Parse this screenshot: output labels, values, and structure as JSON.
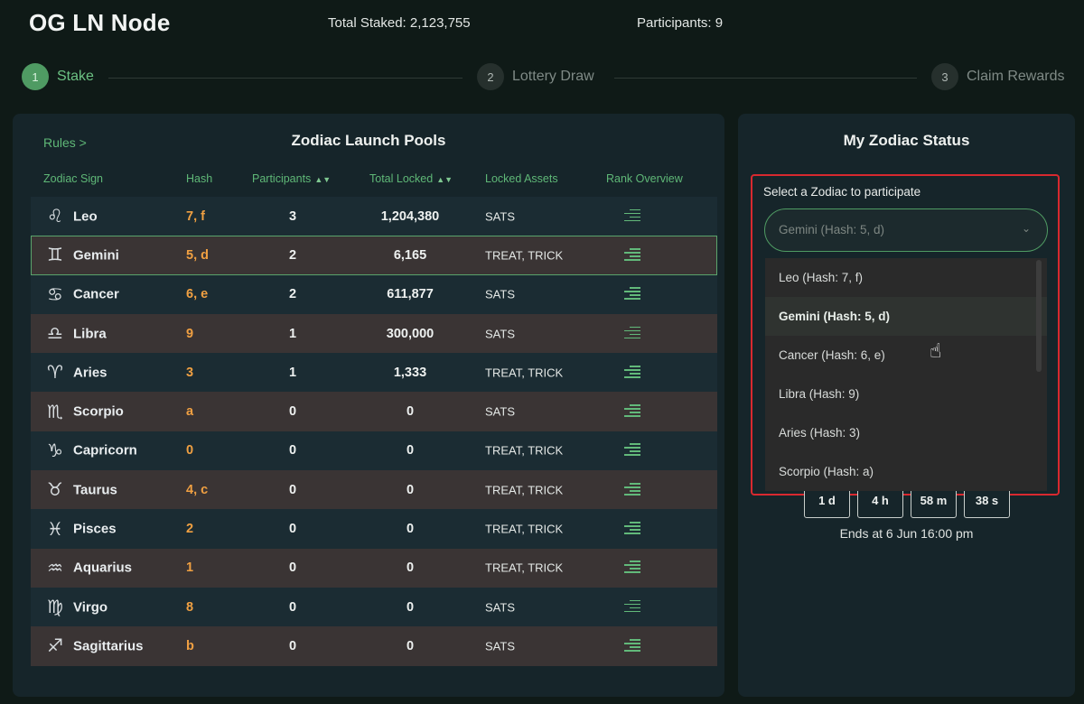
{
  "header": {
    "title": "OG LN Node",
    "total_staked": "Total Staked: 2,123,755",
    "participants": "Participants: 9"
  },
  "steps": [
    {
      "num": "1",
      "label": "Stake",
      "active": true
    },
    {
      "num": "2",
      "label": "Lottery Draw",
      "active": false
    },
    {
      "num": "3",
      "label": "Claim Rewards",
      "active": false
    }
  ],
  "pools": {
    "rules_link": "Rules >",
    "title": "Zodiac Launch Pools",
    "columns": {
      "sign": "Zodiac Sign",
      "hash": "Hash",
      "participants": "Participants",
      "total_locked": "Total Locked",
      "assets": "Locked Assets",
      "rank": "Rank Overview"
    },
    "rows": [
      {
        "icon": "leo-icon",
        "glyph": "♌",
        "name": "Leo",
        "hash": "7, f",
        "participants": "3",
        "total": "1,204,380",
        "assets": "SATS"
      },
      {
        "icon": "gemini-icon",
        "glyph": "♊",
        "name": "Gemini",
        "hash": "5, d",
        "participants": "2",
        "total": "6,165",
        "assets": "TREAT, TRICK",
        "selected": true
      },
      {
        "icon": "cancer-icon",
        "glyph": "♋",
        "name": "Cancer",
        "hash": "6, e",
        "participants": "2",
        "total": "611,877",
        "assets": "SATS"
      },
      {
        "icon": "libra-icon",
        "glyph": "♎",
        "name": "Libra",
        "hash": "9",
        "participants": "1",
        "total": "300,000",
        "assets": "SATS"
      },
      {
        "icon": "aries-icon",
        "glyph": "♈",
        "name": "Aries",
        "hash": "3",
        "participants": "1",
        "total": "1,333",
        "assets": "TREAT, TRICK"
      },
      {
        "icon": "scorpio-icon",
        "glyph": "♏",
        "name": "Scorpio",
        "hash": "a",
        "participants": "0",
        "total": "0",
        "assets": "SATS"
      },
      {
        "icon": "capricorn-icon",
        "glyph": "♑",
        "name": "Capricorn",
        "hash": "0",
        "participants": "0",
        "total": "0",
        "assets": "TREAT, TRICK"
      },
      {
        "icon": "taurus-icon",
        "glyph": "♉",
        "name": "Taurus",
        "hash": "4, c",
        "participants": "0",
        "total": "0",
        "assets": "TREAT, TRICK"
      },
      {
        "icon": "pisces-icon",
        "glyph": "♓",
        "name": "Pisces",
        "hash": "2",
        "participants": "0",
        "total": "0",
        "assets": "TREAT, TRICK"
      },
      {
        "icon": "aquarius-icon",
        "glyph": "♒",
        "name": "Aquarius",
        "hash": "1",
        "participants": "0",
        "total": "0",
        "assets": "TREAT, TRICK"
      },
      {
        "icon": "virgo-icon",
        "glyph": "♍",
        "name": "Virgo",
        "hash": "8",
        "participants": "0",
        "total": "0",
        "assets": "SATS"
      },
      {
        "icon": "sagittarius-icon",
        "glyph": "♐",
        "name": "Sagittarius",
        "hash": "b",
        "participants": "0",
        "total": "0",
        "assets": "SATS"
      }
    ]
  },
  "status": {
    "title": "My Zodiac Status",
    "select_label": "Select a Zodiac to participate",
    "select_value": "Gemini (Hash: 5, d)",
    "options": [
      {
        "label": "Leo (Hash: 7, f)"
      },
      {
        "label": "Gemini (Hash: 5, d)",
        "selected": true
      },
      {
        "label": "Cancer (Hash: 6, e)"
      },
      {
        "label": "Libra (Hash: 9)"
      },
      {
        "label": "Aries (Hash: 3)"
      },
      {
        "label": "Scorpio (Hash: a)"
      }
    ],
    "countdown": [
      "1 d",
      "4 h",
      "58 m",
      "38 s"
    ],
    "ends_at": "Ends at 6 Jun 16:00 pm"
  },
  "colors": {
    "accent": "#5fb877",
    "hash": "#f0a042",
    "highlight": "#d8292f"
  }
}
